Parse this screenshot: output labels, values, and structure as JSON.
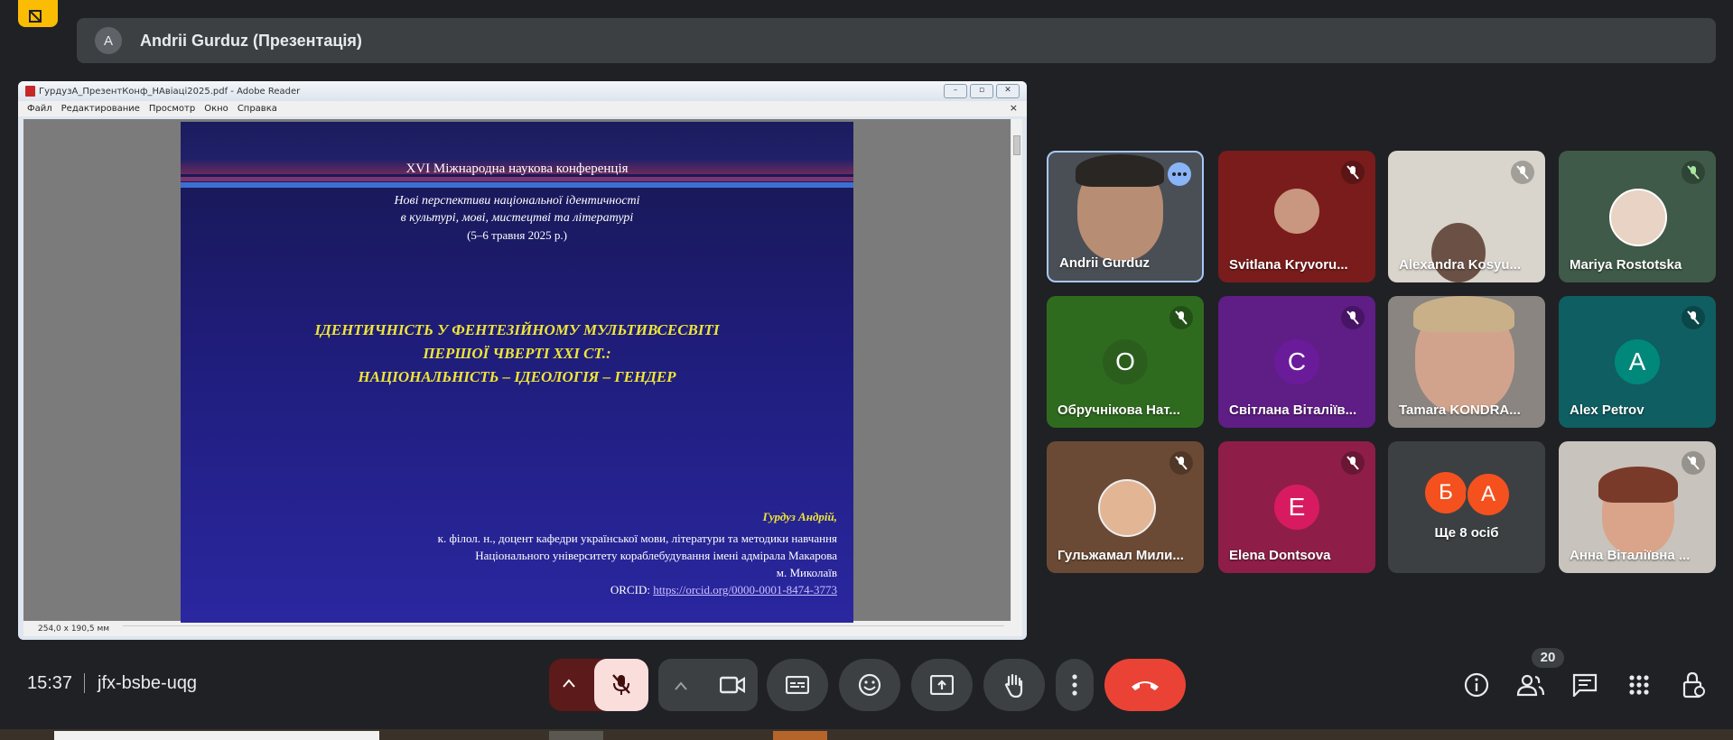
{
  "presentation": {
    "avatar_letter": "A",
    "title": "Andrii Gurduz (Презентація)"
  },
  "window": {
    "title": "ГурдузА_ПрезентКонф_НАвіаці2025.pdf - Adobe Reader",
    "menu": [
      "Файл",
      "Редактирование",
      "Просмотр",
      "Окно",
      "Справка"
    ],
    "status_size": "254,0 x 190,5 мм"
  },
  "slide": {
    "conference": "XVI Міжнародна наукова конференція",
    "subtitle_1": "Нові перспективи національної ідентичності",
    "subtitle_2": "в культурі, мові, мистецтві та літературі",
    "dates": "(5–6 травня 2025 р.)",
    "title_1": "ІДЕНТИЧНІСТЬ У ФЕНТЕЗІЙНОМУ МУЛЬТИВСЕСВІТІ",
    "title_2": "ПЕРШОЇ ЧВЕРТІ ХХІ СТ.:",
    "title_3": "НАЦІОНАЛЬНІСТЬ – ІДЕОЛОГІЯ – ГЕНДЕР",
    "author": "Гурдуз Андрій,",
    "affiliation_1": "к. філол. н., доцент кафедри  української мови, літератури та методики навчання",
    "affiliation_2": "Національного університету кораблебудування імені адмірала Макарова",
    "city": "м. Миколаїв",
    "orcid_label": "ORCID:",
    "orcid_url": "https://orcid.org/0000-0001-8474-3773"
  },
  "participants": [
    {
      "name": "Andrii Gurduz",
      "muted": false,
      "highlighted": true,
      "color": "#4a4f55"
    },
    {
      "name": "Svitlana Kryvoru...",
      "muted": true,
      "color": "#7a1c1c"
    },
    {
      "name": "Alexandra Kosyu...",
      "muted": true,
      "color": "#d9d4cc"
    },
    {
      "name": "Mariya Rostotska",
      "muted": true,
      "color": "#3f5a48"
    },
    {
      "name": "Обручнікова Нат...",
      "muted": true,
      "letter": "О",
      "color": "#2f6b1f",
      "avatar_color": "#2b5e1c"
    },
    {
      "name": "Світлана Віталіїв...",
      "muted": true,
      "letter": "С",
      "color": "#5f1d86",
      "avatar_color": "#6a1b9a"
    },
    {
      "name": "Tamara KONDRA...",
      "muted": false,
      "color": "#8a8580"
    },
    {
      "name": "Alex Petrov",
      "muted": true,
      "letter": "A",
      "color": "#0f5e62",
      "avatar_color": "#00897b"
    },
    {
      "name": "Гульжамал Мили...",
      "muted": true,
      "color": "#6b4a35"
    },
    {
      "name": "Elena Dontsova",
      "muted": true,
      "letter": "E",
      "color": "#8e1e47",
      "avatar_color": "#d81b60"
    },
    {
      "name": "Ще 8 осіб",
      "letters": [
        "Б",
        "A"
      ],
      "color": "#3c4043"
    },
    {
      "name": "Анна Віталіївна ...",
      "muted": true,
      "color": "#c8c3bc"
    }
  ],
  "bottom": {
    "time": "15:37",
    "meeting_code": "jfx-bsbe-uqg",
    "participant_count": "20"
  },
  "colors": {
    "background": "#202124",
    "end_call": "#ea4335",
    "muted_control": "#f9dedc",
    "accent": "#8ab4f8"
  }
}
